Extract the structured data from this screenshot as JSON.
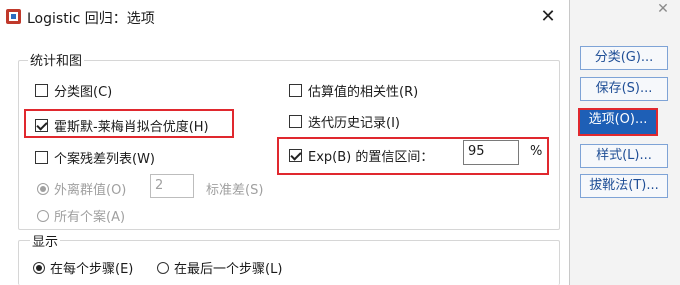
{
  "window": {
    "title": "Logistic 回归：选项",
    "close": "✕"
  },
  "background": {
    "close": "✕"
  },
  "groups": {
    "stats": "统计和图",
    "display": "显示"
  },
  "checkboxes": {
    "classification_plot": "分类图(C)",
    "hosmer_lemeshow": "霍斯默-莱梅肖拟合优度(H)",
    "casewise_list": "个案残差列表(W)",
    "estimate_correlations": "估算值的相关性(R)",
    "iteration_history": "迭代历史记录(I)",
    "ci_exp_b": "Exp(B) 的置信区间："
  },
  "states": {
    "classification_plot": false,
    "hosmer_lemeshow": true,
    "casewise_list": false,
    "estimate_correlations": false,
    "iteration_history": false,
    "ci_exp_b": true
  },
  "ci": {
    "value": "95",
    "unit": "%"
  },
  "casewise": {
    "outliers_label": "外离群值(O)",
    "outliers_value": "2",
    "std_dev_label": "标准差(S)",
    "all_cases_label": "所有个案(A)"
  },
  "display": {
    "each_step": "在每个步骤(E)",
    "last_step": "在最后一个步骤(L)"
  },
  "side_buttons": [
    "分类(G)...",
    "保存(S)...",
    "选项(O)...",
    "样式(L)...",
    "拔靴法(T)..."
  ],
  "colors": {
    "highlight": "#e0282e",
    "active_button": "#1e5fb6",
    "link_text": "#1f4e96"
  }
}
